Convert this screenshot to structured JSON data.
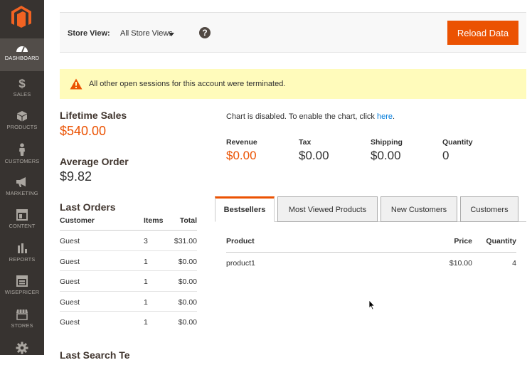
{
  "sidebar": {
    "items": [
      {
        "label": "DASHBOARD",
        "icon": "dashboard-icon",
        "active": true
      },
      {
        "label": "SALES",
        "icon": "dollar-icon"
      },
      {
        "label": "PRODUCTS",
        "icon": "box-icon"
      },
      {
        "label": "CUSTOMERS",
        "icon": "person-icon"
      },
      {
        "label": "MARKETING",
        "icon": "megaphone-icon"
      },
      {
        "label": "CONTENT",
        "icon": "layout-icon"
      },
      {
        "label": "REPORTS",
        "icon": "bar-chart-icon"
      },
      {
        "label": "WISEPRICER",
        "icon": "layout-icon"
      },
      {
        "label": "STORES",
        "icon": "storefront-icon"
      },
      {
        "label": "",
        "icon": "gear-icon"
      }
    ]
  },
  "header": {
    "store_view_label": "Store View:",
    "store_view_value": "All Store Views",
    "help": "?",
    "reload_label": "Reload Data"
  },
  "notice": {
    "text": "All other open sessions for this account were terminated."
  },
  "stats": {
    "lifetime_sales_label": "Lifetime Sales",
    "lifetime_sales_value": "$540.00",
    "average_order_label": "Average Order",
    "average_order_value": "$9.82"
  },
  "last_orders": {
    "title": "Last Orders",
    "headers": [
      "Customer",
      "Items",
      "Total"
    ],
    "rows": [
      [
        "Guest",
        "3",
        "$31.00"
      ],
      [
        "Guest",
        "1",
        "$0.00"
      ],
      [
        "Guest",
        "1",
        "$0.00"
      ],
      [
        "Guest",
        "1",
        "$0.00"
      ],
      [
        "Guest",
        "1",
        "$0.00"
      ]
    ]
  },
  "next_section_partial": "Last Search Te",
  "chart": {
    "message": "Chart is disabled. To enable the chart, click ",
    "link": "here",
    "suffix": "."
  },
  "totals": [
    {
      "label": "Revenue",
      "value": "$0.00"
    },
    {
      "label": "Tax",
      "value": "$0.00"
    },
    {
      "label": "Shipping",
      "value": "$0.00"
    },
    {
      "label": "Quantity",
      "value": "0"
    }
  ],
  "tabs": [
    {
      "label": "Bestsellers",
      "active": true
    },
    {
      "label": "Most Viewed Products"
    },
    {
      "label": "New Customers"
    },
    {
      "label": "Customers"
    }
  ],
  "products": {
    "headers": [
      "Product",
      "Price",
      "Quantity"
    ],
    "rows": [
      [
        "product1",
        "$10.00",
        "4"
      ]
    ]
  },
  "colors": {
    "accent": "#eb5202",
    "sidebar": "#373330",
    "notice": "#fffbbb",
    "link": "#007bdb"
  }
}
